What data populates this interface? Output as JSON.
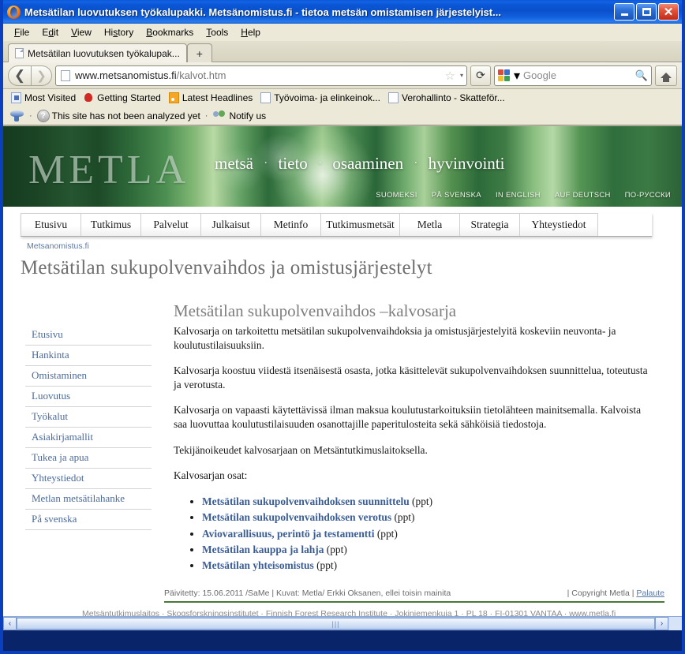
{
  "window": {
    "title": "Metsätilan luovutuksen työkalupakki. Metsänomistus.fi - tietoa metsän omistamisen järjestelyist...",
    "minimize_label": "Minimize",
    "maximize_label": "Maximize",
    "close_label": "✕"
  },
  "menubar": [
    {
      "label": "File"
    },
    {
      "label": "Edit"
    },
    {
      "label": "View"
    },
    {
      "label": "History"
    },
    {
      "label": "Bookmarks"
    },
    {
      "label": "Tools"
    },
    {
      "label": "Help"
    }
  ],
  "tabs": {
    "active": "Metsätilan luovutuksen työkalupak...",
    "newtab_label": "+"
  },
  "navbar": {
    "back_glyph": "◄",
    "forward_glyph": "►",
    "reload_glyph": "⟳",
    "home_label": "Home",
    "url_host": "www.metsanomistus.fi",
    "url_path": "/kalvot.htm",
    "url_full": "www.metsanomistus.fi/kalvot.htm",
    "star_glyph": "☆",
    "caret_glyph": "▾",
    "search_engine": "Google",
    "search_placeholder": "Google",
    "search_glyph": "🔍"
  },
  "bookmarks": [
    {
      "label": "Most Visited",
      "icon": "most-visited-icon"
    },
    {
      "label": "Getting Started",
      "icon": "getting-started-icon"
    },
    {
      "label": "Latest Headlines",
      "icon": "rss-icon"
    },
    {
      "label": "Työvoima- ja elinkeinok...",
      "icon": "page-icon"
    },
    {
      "label": "Verohallinto - Skatteför...",
      "icon": "page-icon"
    }
  ],
  "addonbar": {
    "wot_label": "",
    "status_text": "This site has not been analyzed yet",
    "notify_label": "Notify us",
    "separator": "·"
  },
  "banner": {
    "logo": "METLA",
    "slogan_words": [
      "metsä",
      "tieto",
      "osaaminen",
      "hyvinvointi"
    ],
    "separator": "·",
    "languages": [
      "SUOMEKSI",
      "PÅ SVENSKA",
      "IN ENGLISH",
      "AUF DEUTSCH",
      "ПО-РУССКИ"
    ]
  },
  "site_nav": [
    {
      "label": "Etusivu"
    },
    {
      "label": "Tutkimus"
    },
    {
      "label": "Palvelut"
    },
    {
      "label": "Julkaisut"
    },
    {
      "label": "Metinfo"
    },
    {
      "label": "Tutkimusmetsät",
      "wide": true
    },
    {
      "label": "Metla"
    },
    {
      "label": "Strategia"
    },
    {
      "label": "Yhteystiedot",
      "wide": true
    }
  ],
  "breadcrumb": "Metsanomistus.fi",
  "page_title": "Metsätilan sukupolvenvaihdos ja omistusjärjestelyt",
  "sidebar": {
    "items": [
      {
        "label": "Etusivu"
      },
      {
        "label": "Hankinta"
      },
      {
        "label": "Omistaminen"
      },
      {
        "label": "Luovutus"
      },
      {
        "label": "Työkalut"
      },
      {
        "label": "Asiakirjamallit"
      },
      {
        "label": "Tukea ja apua"
      },
      {
        "label": "Yhteystiedot"
      },
      {
        "label": "Metlan metsätilahanke"
      },
      {
        "label": "På svenska"
      }
    ]
  },
  "main": {
    "heading": "Metsätilan sukupolvenvaihdos –kalvosarja",
    "paragraphs": [
      "Kalvosarja on tarkoitettu metsätilan sukupolvenvaihdoksia ja omistusjärjestelyitä koskeviin neuvonta- ja koulutustilaisuuksiin.",
      "Kalvosarja koostuu viidestä itsenäisestä osasta, jotka käsittelevät sukupolvenvaihdoksen suunnittelua, toteutusta ja verotusta.",
      "Kalvosarja on vapaasti käytettävissä ilman maksua koulutustarkoituksiin tietolähteen mainitsemalla. Kalvoista saa luovuttaa koulutustilaisuuden osanottajille paperitulosteita sekä sähköisiä tiedostoja.",
      "Tekijänoikeudet kalvosarjaan on Metsäntutkimuslaitoksella.",
      "Kalvosarjan osat:"
    ],
    "links": [
      {
        "label": "Metsätilan sukupolvenvaihdoksen suunnittelu",
        "format": "(ppt)"
      },
      {
        "label": "Metsätilan sukupolvenvaihdoksen verotus",
        "format": "(ppt)"
      },
      {
        "label": "Aviovarallisuus, perintö ja testamentti",
        "format": "(ppt)"
      },
      {
        "label": "Metsätilan kauppa ja lahja",
        "format": "(ppt)"
      },
      {
        "label": "Metsätilan yhteisomistus",
        "format": "(ppt)"
      }
    ]
  },
  "page_footer": {
    "left": "Päivitetty: 15.06.2011 /SaMe | Kuvat: Metla/ Erkki Oksanen, ellei toisin mainita",
    "copyright": "| Copyright Metla |",
    "feedback": "Palaute"
  },
  "bottom_strip": "Metsäntutkimuslaitos · Skogsforskningsinstitutet · Finnish Forest Research Institute · Jokiniemenkuja 1 · PL 18 · FI-01301 VANTAA · www.metla.fi",
  "scrollbar": {
    "left_glyph": "‹",
    "right_glyph": "›",
    "thumb_grip": "|||"
  },
  "colors": {
    "titlebar_blue": "#0a50cc",
    "banner_green": "#2f6b3a",
    "link_blue": "#3b5e97",
    "sidebar_link": "#4a6a9a",
    "footer_rule": "#4a7a3a"
  }
}
